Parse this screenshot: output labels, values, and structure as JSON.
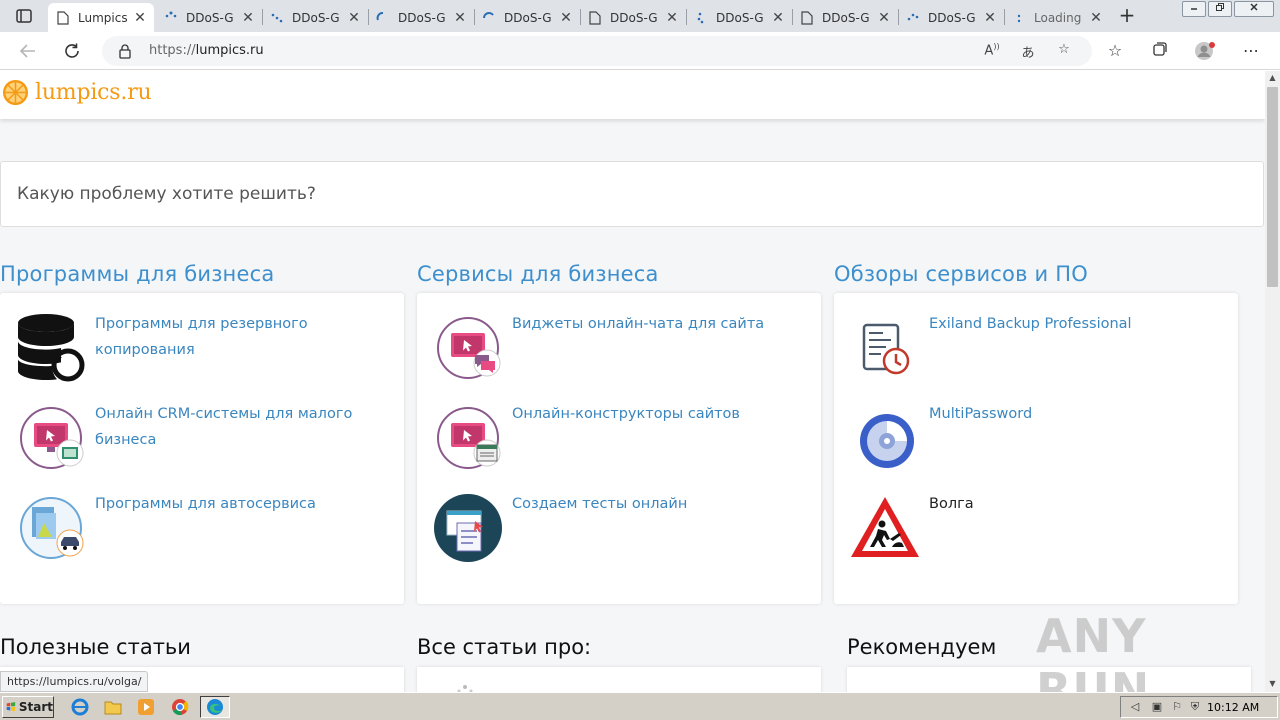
{
  "browser": {
    "tabs": [
      {
        "title": "Lumpics",
        "icon": "page-icon",
        "active": true
      },
      {
        "title": "DDoS-G",
        "icon": "loading-spinner-icon"
      },
      {
        "title": "DDoS-G",
        "icon": "loading-spinner-icon"
      },
      {
        "title": "DDoS-G",
        "icon": "loading-spinner-icon"
      },
      {
        "title": "DDoS-G",
        "icon": "loading-spinner-icon"
      },
      {
        "title": "DDoS-G",
        "icon": "page-icon"
      },
      {
        "title": "DDoS-G",
        "icon": "loading-spinner-icon"
      },
      {
        "title": "DDoS-G",
        "icon": "page-icon"
      },
      {
        "title": "DDoS-G",
        "icon": "loading-spinner-icon"
      },
      {
        "title": "Loading",
        "icon": "loading-spinner-icon"
      }
    ],
    "close_glyph": "✕",
    "new_tab_glyph": "+",
    "address": {
      "scheme": "https://",
      "host": "lumpics.ru"
    }
  },
  "site": {
    "logo_text": "lumpics.ru",
    "search_placeholder": "Какую проблему хотите решить?",
    "columns": [
      {
        "title": "Программы для бизнеса",
        "items": [
          {
            "label": "Программы для резервного копирования",
            "icon": "database-backup-icon"
          },
          {
            "label": "Онлайн CRM-системы для малого бизнеса",
            "icon": "crm-monitor-icon"
          },
          {
            "label": "Программы для автосервиса",
            "icon": "auto-service-icon"
          }
        ]
      },
      {
        "title": "Сервисы для бизнеса",
        "items": [
          {
            "label": "Виджеты онлайн-чата для сайта",
            "icon": "chat-widget-icon"
          },
          {
            "label": "Онлайн-конструкторы сайтов",
            "icon": "site-builder-icon"
          },
          {
            "label": "Создаем тесты онлайн",
            "icon": "online-test-icon"
          }
        ]
      },
      {
        "title": "Обзоры сервисов и ПО",
        "items": [
          {
            "label": "Exiland Backup Professional",
            "icon": "exiland-backup-icon"
          },
          {
            "label": "MultiPassword",
            "icon": "multipassword-icon"
          },
          {
            "label": "Волга",
            "icon": "road-works-icon"
          }
        ]
      }
    ],
    "sections": [
      {
        "title": "Полезные статьи"
      },
      {
        "title": "Все статьи про:"
      },
      {
        "title": "Рекомендуем"
      }
    ],
    "watermark": "ANY RUN",
    "status_url": "https://lumpics.ru/volga/"
  },
  "taskbar": {
    "start_label": "Start",
    "clock": "10:12 AM"
  },
  "colors": {
    "accent_link": "#3a86bf",
    "column_title": "#3d8fce",
    "logo_orange": "#f59a13"
  }
}
